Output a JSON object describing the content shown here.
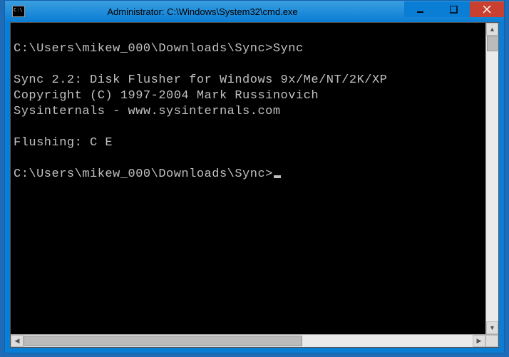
{
  "window": {
    "title": "Administrator: C:\\Windows\\System32\\cmd.exe"
  },
  "console": {
    "lines": [
      "",
      "C:\\Users\\mikew_000\\Downloads\\Sync>Sync",
      "",
      "Sync 2.2: Disk Flusher for Windows 9x/Me/NT/2K/XP",
      "Copyright (C) 1997-2004 Mark Russinovich",
      "Sysinternals - www.sysinternals.com",
      "",
      "Flushing: C E",
      "",
      "C:\\Users\\mikew_000\\Downloads\\Sync>"
    ]
  }
}
